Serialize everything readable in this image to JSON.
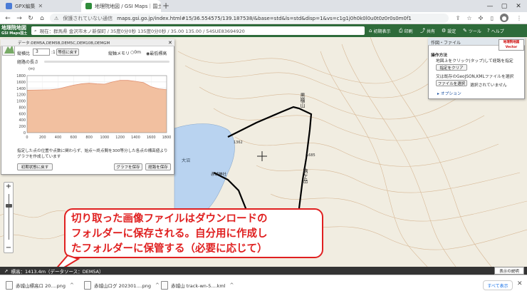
{
  "browser": {
    "tabs": [
      {
        "label": "GPX編集"
      },
      {
        "label": "地理院地図 / GSI Maps｜国土地"
      }
    ],
    "new_tab": "+",
    "address": {
      "security": "保護されていない通信",
      "url": "maps.gsi.go.jp/index.html#15/36.554575/139.187538/&base=std&ls=std&disp=1&vs=c1g1j0h0k0l0u0t0z0r0s0m0f1"
    }
  },
  "map_header": {
    "logo_line1": "地理院地図",
    "logo_line2": "GSI Maps国土Web",
    "search_text": "現在：群馬県 金沢市木ノ新保町 / 35度0分0秒 135度0分0秒 / 35.00 135.00 / 54SUE83694920",
    "buttons": [
      {
        "label": "初期表示",
        "icon": "home-icon"
      },
      {
        "label": "印刷",
        "icon": "print-icon"
      },
      {
        "label": "共有",
        "icon": "share-icon"
      },
      {
        "label": "設定",
        "icon": "gear-icon"
      },
      {
        "label": "ツール",
        "icon": "tool-icon"
      },
      {
        "label": "ヘルプ",
        "icon": "help-icon"
      }
    ]
  },
  "elevation_panel": {
    "title": "データ:DEM5A,DEM5B,DEM5C,DEM10B,DEMGM",
    "vertical_scale_label": "縦横比",
    "vertical_scale_value": "3",
    "vertical_scale_sep": ":1",
    "equal_button": "等倍に戻す",
    "memory_label": "縦軸メモリ",
    "memory_opt1": "0m",
    "memory_opt2": "最低標高",
    "length_label": "経路の長さ",
    "y_unit": "(m)",
    "note": "指定した点の位置や点数に関わらず、始点〜終点間を300等分した各点の標高値よりグラフを作成しています",
    "reset_button": "初期状態に戻す",
    "save_graph_button": "グラフを保存",
    "save_path_button": "経路を保存"
  },
  "chart_data": {
    "type": "area",
    "x": [
      0,
      100,
      200,
      300,
      400,
      500,
      600,
      700,
      800,
      900,
      1000,
      1100,
      1200,
      1300,
      1400,
      1500,
      1600,
      1700,
      1800
    ],
    "values": [
      1340,
      1345,
      1350,
      1355,
      1380,
      1440,
      1500,
      1540,
      1560,
      1540,
      1530,
      1600,
      1650,
      1650,
      1620,
      1580,
      1450,
      1380,
      1355
    ],
    "xlim": [
      0,
      1800
    ],
    "ylim": [
      0,
      1800
    ],
    "x_ticks": [
      "0",
      "200",
      "400",
      "600",
      "800",
      "1000",
      "1200",
      "1400",
      "1600",
      "1800"
    ],
    "y_ticks": [
      "1800",
      "1600",
      "1400",
      "1200",
      "1000",
      "800",
      "600",
      "400",
      "200",
      "0"
    ],
    "ylabel": "(m)",
    "grid": true,
    "fill_color": "#f2c0a0",
    "line_color": "#e09070"
  },
  "draw_panel": {
    "title": "作図・ファイル",
    "section": "操作方法",
    "line1": "地図上をクリック(タップ)して経路を指定",
    "clear_button": "指定をクリア",
    "line2": "又は既存のGeoJSON,KMLファイルを選択",
    "file_button": "ファイルを選択",
    "no_file": "選択されていません",
    "options": "オプション",
    "vector_badge": "地理院地図 Vector"
  },
  "map_labels": {
    "peak1": "黒檜山",
    "peak2": "駒ケ岳",
    "lake": "大沼",
    "shrine": "赤城神社",
    "elev1": "1362",
    "elev2": "1685"
  },
  "callout": {
    "line1": "切り取った画像ファイルはダウンロードの",
    "line2": "フォルダーに保存される。自分用に作成し",
    "line3": "たフォルダーに保管する（必要に応じて）"
  },
  "map_status": {
    "text": "標高：1413.4m（データソース：DEM5A）",
    "right_button": "表示の説明"
  },
  "downloads": {
    "items": [
      {
        "label": "赤城山標高ロ 20....png"
      },
      {
        "label": "赤城山ログ 202301....png"
      },
      {
        "label": "赤城山 track-wn-5....kml"
      }
    ],
    "show_all": "すべて表示",
    "close": "✕"
  },
  "colors": {
    "header_green": "#2e6b3a",
    "callout_red": "#e02020",
    "lake_blue": "#b9d3f0"
  }
}
